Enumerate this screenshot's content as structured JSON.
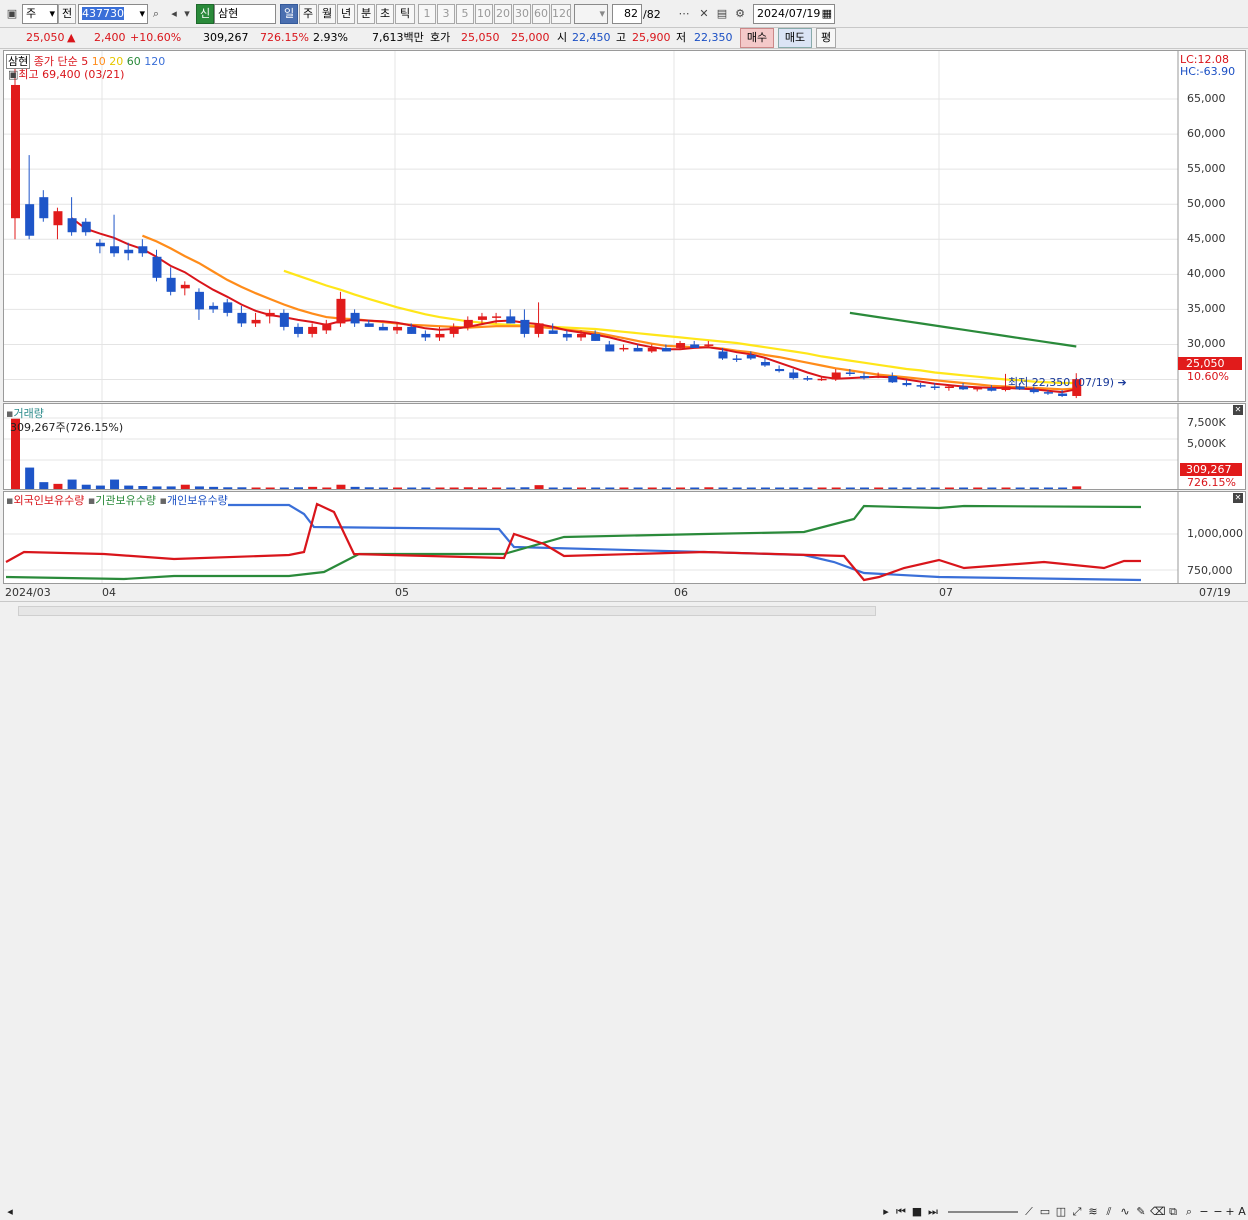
{
  "toolbar": {
    "market": "주",
    "prev_label": "전",
    "code": "437730",
    "badge": "신",
    "name": "삼현",
    "periods": [
      "일",
      "주",
      "월",
      "년",
      "분",
      "초",
      "틱"
    ],
    "selected_period": "일",
    "intervals": [
      "1",
      "3",
      "5",
      "10",
      "20",
      "30",
      "60",
      "120"
    ],
    "count": "82",
    "total": "/82",
    "date": "2024/07/19"
  },
  "quote": {
    "price": "25,050",
    "change": "2,400",
    "rate": "+10.60%",
    "volume": "309,267",
    "vol_rate": "726.15%",
    "turnover": "2.93%",
    "amount": "7,613백만",
    "ask_label": "호가",
    "ask": "25,050",
    "bid": "25,000",
    "open_label": "시",
    "open": "22,450",
    "high_label": "고",
    "high": "25,900",
    "low_label": "저",
    "low": "22,350",
    "buy_label": "매수",
    "sell_label": "매도",
    "eval_label": "평"
  },
  "price_panel": {
    "name_tag": "삼현",
    "legend_prefix": "종가 단순",
    "ma_labels": [
      "5",
      "10",
      "20",
      "60",
      "120"
    ],
    "ma_colors": [
      "#d9151b",
      "#ff8c1a",
      "#ffe619",
      "#2a8a3a",
      "#3a6fd8"
    ],
    "high_note": "최고 69,400 (03/21)",
    "low_note": "최저 22,350 (07/19)",
    "lc": "LC:12.08",
    "hc": "HC:-63.90",
    "y_ticks": [
      "65,000",
      "60,000",
      "55,000",
      "50,000",
      "45,000",
      "40,000",
      "35,000",
      "30,000"
    ],
    "last_price": "25,050",
    "last_rate": "10.60%"
  },
  "volume_panel": {
    "title": "거래량",
    "info": "309,267주(726.15%)",
    "y_ticks": [
      "7,500K",
      "5,000K",
      "2,500K"
    ],
    "last_volume": "309,267",
    "last_rate": "726.15%"
  },
  "holdings_panel": {
    "legends": [
      "외국인보유수량",
      "기관보유수량",
      "개인보유수량"
    ],
    "colors": {
      "foreign": "#d9151b",
      "institution": "#2a8a3a",
      "individual": "#3a6fd8"
    },
    "y_ticks": [
      "1,000,000",
      "750,000"
    ]
  },
  "x_labels": [
    "2024/03",
    "04",
    "05",
    "06",
    "07",
    "07/19"
  ],
  "chart_data": {
    "type": "candlestick",
    "title": "",
    "xlabel": "",
    "ylabel": "",
    "ylim": [
      21000,
      69500
    ],
    "candles_ohlc": [
      [
        48000,
        69400,
        45000,
        67000
      ],
      [
        50000,
        57000,
        45000,
        45500
      ],
      [
        51000,
        52000,
        47500,
        48000
      ],
      [
        47000,
        49500,
        45000,
        49000
      ],
      [
        48000,
        51000,
        45500,
        46000
      ],
      [
        47500,
        48000,
        45500,
        46000
      ],
      [
        44500,
        45000,
        43000,
        44000
      ],
      [
        44000,
        48500,
        42500,
        43000
      ],
      [
        43500,
        44500,
        42000,
        43000
      ],
      [
        44000,
        45000,
        42500,
        43000
      ],
      [
        42500,
        43500,
        39000,
        39500
      ],
      [
        39500,
        41000,
        37000,
        37500
      ],
      [
        38000,
        39000,
        37000,
        38500
      ],
      [
        37500,
        38000,
        33500,
        35000
      ],
      [
        35500,
        36000,
        34500,
        35000
      ],
      [
        36000,
        36500,
        34000,
        34500
      ],
      [
        34500,
        35500,
        32500,
        33000
      ],
      [
        33000,
        34500,
        32500,
        33500
      ],
      [
        34000,
        35000,
        33000,
        34500
      ],
      [
        34500,
        35000,
        32000,
        32500
      ],
      [
        32500,
        33000,
        31000,
        31500
      ],
      [
        31500,
        33000,
        31000,
        32500
      ],
      [
        32000,
        33500,
        31500,
        33000
      ],
      [
        33000,
        37500,
        32500,
        36500
      ],
      [
        34500,
        35000,
        32500,
        33000
      ],
      [
        33000,
        33500,
        32500,
        32500
      ],
      [
        32500,
        33000,
        32000,
        32000
      ],
      [
        32000,
        33000,
        31500,
        32500
      ],
      [
        32500,
        33000,
        31500,
        31500
      ],
      [
        31500,
        32000,
        30500,
        31000
      ],
      [
        31000,
        32500,
        30500,
        31500
      ],
      [
        31500,
        33000,
        31000,
        32500
      ],
      [
        32500,
        34000,
        32000,
        33500
      ],
      [
        33500,
        34500,
        33000,
        34000
      ],
      [
        34000,
        34500,
        33000,
        34000
      ],
      [
        34000,
        35000,
        33000,
        33000
      ],
      [
        33500,
        35000,
        31000,
        31500
      ],
      [
        31500,
        36000,
        31000,
        33000
      ],
      [
        32000,
        33000,
        31500,
        31500
      ],
      [
        31500,
        32000,
        30500,
        31000
      ],
      [
        31000,
        32000,
        30500,
        31500
      ],
      [
        31500,
        32000,
        30500,
        30500
      ],
      [
        30000,
        30500,
        29000,
        29000
      ],
      [
        29500,
        30000,
        29000,
        29500
      ],
      [
        29500,
        30000,
        29000,
        29000
      ],
      [
        29000,
        30000,
        28800,
        29500
      ],
      [
        29500,
        30000,
        29000,
        29000
      ],
      [
        29500,
        30500,
        29200,
        30200
      ],
      [
        30000,
        30500,
        29500,
        29500
      ],
      [
        29800,
        30500,
        29500,
        30000
      ],
      [
        29000,
        29500,
        27800,
        28000
      ],
      [
        28000,
        28500,
        27500,
        27800
      ],
      [
        28500,
        29000,
        27800,
        28000
      ],
      [
        27500,
        28000,
        26800,
        27000
      ],
      [
        26500,
        27000,
        26000,
        26200
      ],
      [
        26000,
        26500,
        25000,
        25200
      ],
      [
        25200,
        25500,
        24800,
        25000
      ],
      [
        25000,
        25500,
        24800,
        25100
      ],
      [
        25000,
        26500,
        24800,
        26000
      ],
      [
        26000,
        26500,
        25500,
        25800
      ],
      [
        25500,
        26000,
        25000,
        25200
      ],
      [
        25500,
        26000,
        25200,
        25500
      ],
      [
        25500,
        26000,
        24500,
        24600
      ],
      [
        24500,
        25000,
        24000,
        24200
      ],
      [
        24200,
        24500,
        23800,
        24000
      ],
      [
        24000,
        24500,
        23500,
        23800
      ],
      [
        23800,
        24200,
        23400,
        24000
      ],
      [
        24000,
        24500,
        23500,
        23600
      ],
      [
        23600,
        24000,
        23300,
        23800
      ],
      [
        23800,
        24200,
        23300,
        23400
      ],
      [
        23500,
        25800,
        23300,
        24000
      ],
      [
        24000,
        24500,
        23500,
        23600
      ],
      [
        23600,
        24000,
        23000,
        23200
      ],
      [
        23200,
        23500,
        22800,
        23000
      ],
      [
        23000,
        23500,
        22500,
        22650
      ],
      [
        22650,
        25900,
        22350,
        25050
      ]
    ],
    "ma5": [
      null,
      null,
      null,
      null,
      48000,
      46500,
      45800,
      45200,
      44300,
      43600,
      42500,
      41200,
      40300,
      39000,
      37800,
      36800,
      35700,
      34800,
      34200,
      33900,
      33500,
      33200,
      32800,
      33300,
      33500,
      33400,
      33300,
      33100,
      32700,
      32300,
      32100,
      32200,
      32500,
      32900,
      33300,
      33400,
      33100,
      32900,
      32500,
      32000,
      31700,
      31400,
      31000,
      30500,
      30000,
      29600,
      29300,
      29300,
      29500,
      29600,
      29300,
      28900,
      28600,
      28100,
      27400,
      26700,
      26000,
      25400,
      25100,
      25200,
      25300,
      25400,
      25300,
      25000,
      24700,
      24400,
      24200,
      24000,
      23900,
      23800,
      23800,
      23700,
      23600,
      23400,
      23200,
      23600
    ],
    "ma10": [
      null,
      null,
      null,
      null,
      null,
      null,
      null,
      null,
      null,
      45500,
      44700,
      43700,
      42600,
      41600,
      40400,
      39200,
      38200,
      37300,
      36500,
      35700,
      35000,
      34400,
      33900,
      33700,
      33600,
      33400,
      33200,
      33000,
      32800,
      32700,
      32600,
      32500,
      32400,
      32500,
      32600,
      32600,
      32600,
      32500,
      32300,
      32100,
      31900,
      31700,
      31300,
      30900,
      30500,
      30100,
      29800,
      29700,
      29600,
      29600,
      29400,
      29100,
      28900,
      28500,
      28200,
      27800,
      27400,
      27000,
      26600,
      26300,
      26000,
      25700,
      25500,
      25300,
      25100,
      24900,
      24700,
      24500,
      24300,
      24100,
      24000,
      23900,
      23800,
      23700,
      23600,
      23700
    ],
    "ma20": [
      null,
      null,
      null,
      null,
      null,
      null,
      null,
      null,
      null,
      null,
      null,
      null,
      null,
      null,
      null,
      null,
      null,
      null,
      null,
      40500,
      39800,
      39100,
      38400,
      37800,
      37100,
      36500,
      35900,
      35300,
      34800,
      34300,
      33900,
      33600,
      33300,
      33100,
      32900,
      32800,
      32700,
      32600,
      32500,
      32400,
      32300,
      32200,
      32000,
      31800,
      31600,
      31400,
      31200,
      31000,
      30800,
      30600,
      30400,
      30200,
      29900,
      29600,
      29300,
      29000,
      28700,
      28300,
      28000,
      27700,
      27400,
      27100,
      26800,
      26500,
      26300,
      26000,
      25800,
      25600,
      25400,
      25200,
      25000,
      24900,
      24700,
      24600,
      24500,
      24500
    ],
    "ma60": [
      null,
      null,
      null,
      null,
      null,
      null,
      null,
      null,
      null,
      null,
      null,
      null,
      null,
      null,
      null,
      null,
      null,
      null,
      null,
      null,
      null,
      null,
      null,
      null,
      null,
      null,
      null,
      null,
      null,
      null,
      null,
      null,
      null,
      null,
      null,
      null,
      null,
      null,
      null,
      null,
      null,
      null,
      null,
      null,
      null,
      null,
      null,
      null,
      null,
      null,
      null,
      null,
      null,
      null,
      null,
      null,
      null,
      null,
      null,
      34500,
      34200,
      33900,
      33600,
      33300,
      33000,
      32700,
      32400,
      32100,
      31800,
      31500,
      31200,
      30900,
      30600,
      30300,
      30000,
      29700
    ],
    "volume": [
      8200,
      2500,
      800,
      600,
      1100,
      500,
      400,
      1100,
      400,
      350,
      300,
      300,
      500,
      300,
      250,
      200,
      200,
      150,
      150,
      150,
      200,
      250,
      150,
      500,
      250,
      200,
      150,
      150,
      150,
      120,
      150,
      150,
      200,
      150,
      150,
      150,
      200,
      450,
      150,
      150,
      120,
      120,
      150,
      120,
      120,
      120,
      150,
      150,
      120,
      200,
      120,
      120,
      150,
      120,
      120,
      110,
      100,
      110,
      150,
      120,
      120,
      120,
      110,
      100,
      100,
      100,
      110,
      100,
      100,
      110,
      150,
      100,
      100,
      90,
      80,
      309
    ]
  }
}
